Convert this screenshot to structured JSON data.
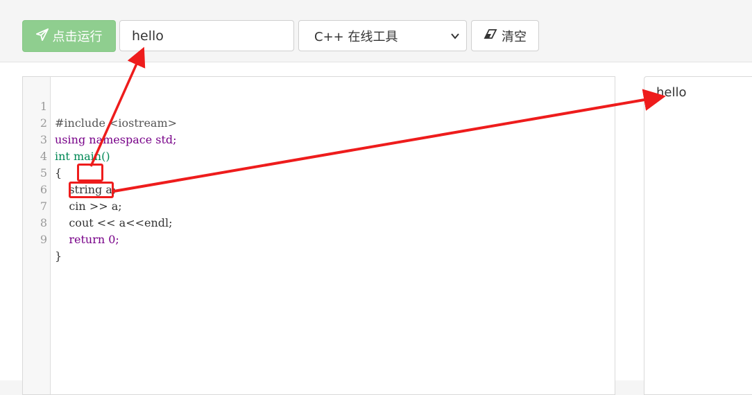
{
  "toolbar": {
    "run_label": "点击运行",
    "stdin_value": "hello",
    "language_selected": "C++ 在线工具",
    "clear_label": "清空"
  },
  "editor": {
    "lines": [
      {
        "no": "1",
        "text": "#include <iostream>"
      },
      {
        "no": "2",
        "text": "using namespace std;"
      },
      {
        "no": "3",
        "text": "int main()"
      },
      {
        "no": "4",
        "text": "{"
      },
      {
        "no": "5",
        "text": "    string a;"
      },
      {
        "no": "6",
        "text": "    cin >> a;"
      },
      {
        "no": "7",
        "text": "    cout << a<<endl;"
      },
      {
        "no": "8",
        "text": "    return 0;"
      },
      {
        "no": "9",
        "text": "}"
      }
    ]
  },
  "output": {
    "text": "hello"
  },
  "colors": {
    "run_button": "#8fce8f",
    "annotation": "#ee1c1c",
    "keyword": "#770088",
    "type": "#008855",
    "function": "#0000cc"
  },
  "icons": {
    "run": "paper-plane-icon",
    "clear": "eraser-icon",
    "select": "chevron-down-icon"
  }
}
